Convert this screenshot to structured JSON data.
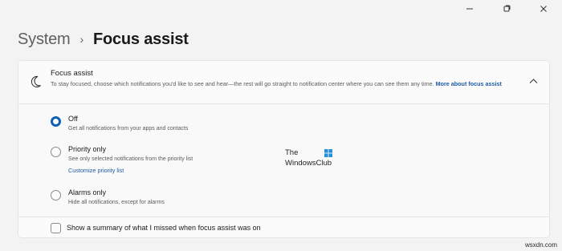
{
  "window": {
    "minimize_icon": "minimize-icon",
    "maximize_icon": "maximize-icon",
    "close_icon": "close-icon"
  },
  "breadcrumb": {
    "parent": "System",
    "separator": "›",
    "current": "Focus assist"
  },
  "focus_assist": {
    "title": "Focus assist",
    "description": "To stay focused, choose which notifications you'd like to see and hear—the rest will go straight to notification center where you can see them any time.",
    "more_link": "More about focus assist",
    "expanded": true
  },
  "options": [
    {
      "title": "Off",
      "description": "Get all notifications from your apps and contacts",
      "checked": true
    },
    {
      "title": "Priority only",
      "description": "See only selected notifications from the priority list",
      "link": "Customize priority list",
      "checked": false
    },
    {
      "title": "Alarms only",
      "description": "Hide all notifications, except for alarms",
      "checked": false
    }
  ],
  "summary_checkbox": {
    "label": "Show a summary of what I missed when focus assist was on",
    "checked": false
  },
  "watermark": {
    "line1": "The",
    "line2": "WindowsClub"
  },
  "site_mark": "wsxdn.com",
  "colors": {
    "accent": "#0f5fb5",
    "link": "#1d5aa6",
    "background": "#f3f3f3",
    "card": "#fbfbfb"
  }
}
